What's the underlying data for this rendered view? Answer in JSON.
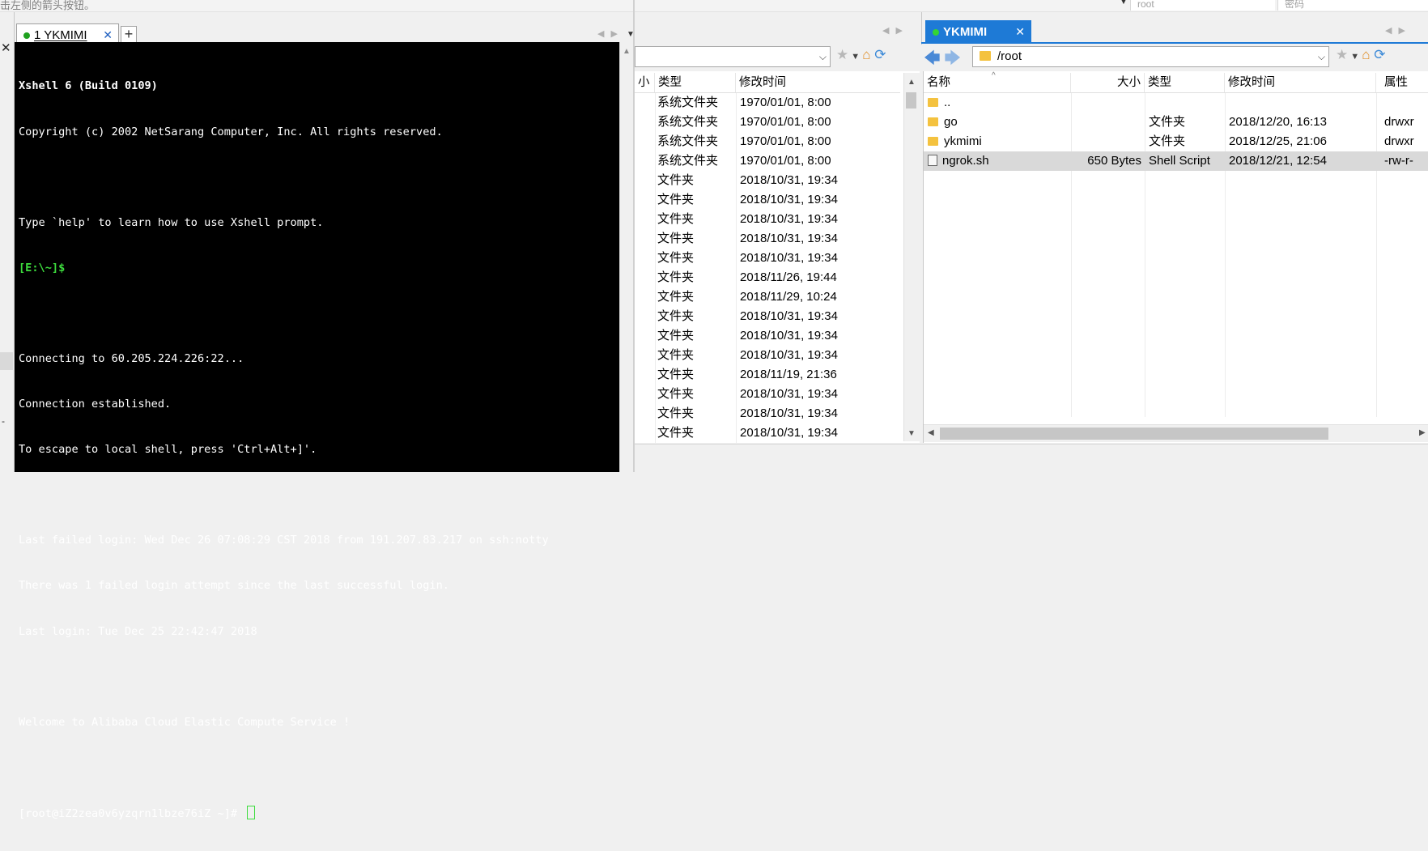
{
  "top": {
    "hint_text": "击左侧的箭头按钮。",
    "field_user": "root",
    "field_password": "密码"
  },
  "session_tab": {
    "label": "1 YKMIMI",
    "close": "✕",
    "plus": "+"
  },
  "terminal": {
    "lines": [
      "Xshell 6 (Build 0109)",
      "Copyright (c) 2002 NetSarang Computer, Inc. All rights reserved.",
      "",
      "Type `help' to learn how to use Xshell prompt.",
      "[E:\\~]$",
      "",
      "Connecting to 60.205.224.226:22...",
      "Connection established.",
      "To escape to local shell, press 'Ctrl+Alt+]'.",
      "",
      "Last failed login: Wed Dec 26 07:08:29 CST 2018 from 191.207.83.217 on ssh:notty",
      "There was 1 failed login attempt since the last successful login.",
      "Last login: Tue Dec 25 22:42:47 2018",
      "",
      "Welcome to Alibaba Cloud Elastic Compute Service !",
      "",
      "[root@iZ2zea0v6yzqrn1lbze76iZ ~]# "
    ]
  },
  "local_panel": {
    "headers": {
      "size": "小",
      "type": "类型",
      "modified": "修改时间"
    },
    "rows": [
      {
        "type": "系统文件夹",
        "modified": "1970/01/01, 8:00"
      },
      {
        "type": "系统文件夹",
        "modified": "1970/01/01, 8:00"
      },
      {
        "type": "系统文件夹",
        "modified": "1970/01/01, 8:00"
      },
      {
        "type": "系统文件夹",
        "modified": "1970/01/01, 8:00"
      },
      {
        "type": "文件夹",
        "modified": "2018/10/31, 19:34"
      },
      {
        "type": "文件夹",
        "modified": "2018/10/31, 19:34"
      },
      {
        "type": "文件夹",
        "modified": "2018/10/31, 19:34"
      },
      {
        "type": "文件夹",
        "modified": "2018/10/31, 19:34"
      },
      {
        "type": "文件夹",
        "modified": "2018/10/31, 19:34"
      },
      {
        "type": "文件夹",
        "modified": "2018/11/26, 19:44"
      },
      {
        "type": "文件夹",
        "modified": "2018/11/29, 10:24"
      },
      {
        "type": "文件夹",
        "modified": "2018/10/31, 19:34"
      },
      {
        "type": "文件夹",
        "modified": "2018/10/31, 19:34"
      },
      {
        "type": "文件夹",
        "modified": "2018/10/31, 19:34"
      },
      {
        "type": "文件夹",
        "modified": "2018/11/19, 21:36"
      },
      {
        "type": "文件夹",
        "modified": "2018/10/31, 19:34"
      },
      {
        "type": "文件夹",
        "modified": "2018/10/31, 19:34"
      },
      {
        "type": "文件夹",
        "modified": "2018/10/31, 19:34"
      }
    ]
  },
  "remote_tab": {
    "label": "YKMIMI",
    "close": "✕"
  },
  "remote_panel": {
    "path": "/root",
    "headers": {
      "name": "名称",
      "size": "大小",
      "type": "类型",
      "modified": "修改时间",
      "attr": "属性"
    },
    "rows": [
      {
        "name": "..",
        "size": "",
        "type": "",
        "modified": "",
        "attr": "",
        "icon": "folder-icon"
      },
      {
        "name": "go",
        "size": "",
        "type": "文件夹",
        "modified": "2018/12/20, 16:13",
        "attr": "drwxr",
        "icon": "folder-icon"
      },
      {
        "name": "ykmimi",
        "size": "",
        "type": "文件夹",
        "modified": "2018/12/25, 21:06",
        "attr": "drwxr",
        "icon": "folder-icon"
      },
      {
        "name": "ngrok.sh",
        "size": "650 Bytes",
        "type": "Shell Script",
        "modified": "2018/12/21, 12:54",
        "attr": "-rw-r-",
        "icon": "file-icon"
      }
    ]
  }
}
